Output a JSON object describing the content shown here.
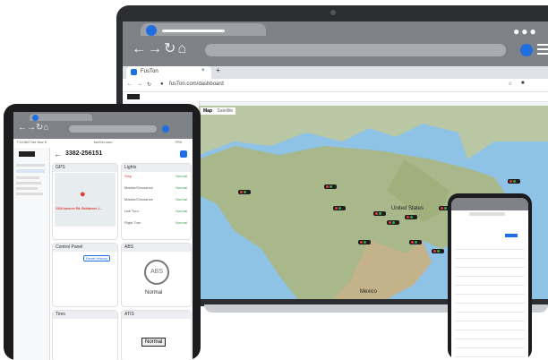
{
  "browser": {
    "tab_title": "FusTon",
    "url": "fusTon.com/dashboard"
  },
  "map_tabs": [
    "Map",
    "Satellite"
  ],
  "map_labels": {
    "country_us": "United States",
    "country_mx": "Mexico"
  },
  "tablet": {
    "time": "7:14 AM  Tue Nov 5",
    "url": "fusTon.com",
    "battery": "79%",
    "device_id": "3382-256151",
    "gps_title": "GPS",
    "gps_address": "1330 Amoree Rd, Baldavore, I...",
    "lights_title": "Lights",
    "lights": [
      {
        "label": "Stop",
        "value": "Normal"
      },
      {
        "label": "Marker/Clearance",
        "value": "Normal"
      },
      {
        "label": "Marker/Clearance",
        "value": "Normal"
      },
      {
        "label": "Left Turn",
        "value": "Normal"
      },
      {
        "label": "Right Turn",
        "value": "Normal"
      }
    ],
    "control_panel_title": "Control Panel",
    "abs_title": "ABS",
    "abs_label": "ABS",
    "abs_status": "Normal",
    "tires_title": "Tires",
    "atis_title": "ATIS",
    "atis_status": "Normal",
    "reset_button": "Reset History"
  },
  "colors": {
    "accent": "#1f6fe3",
    "ok": "#3aa24a",
    "stop": "#e53935"
  }
}
